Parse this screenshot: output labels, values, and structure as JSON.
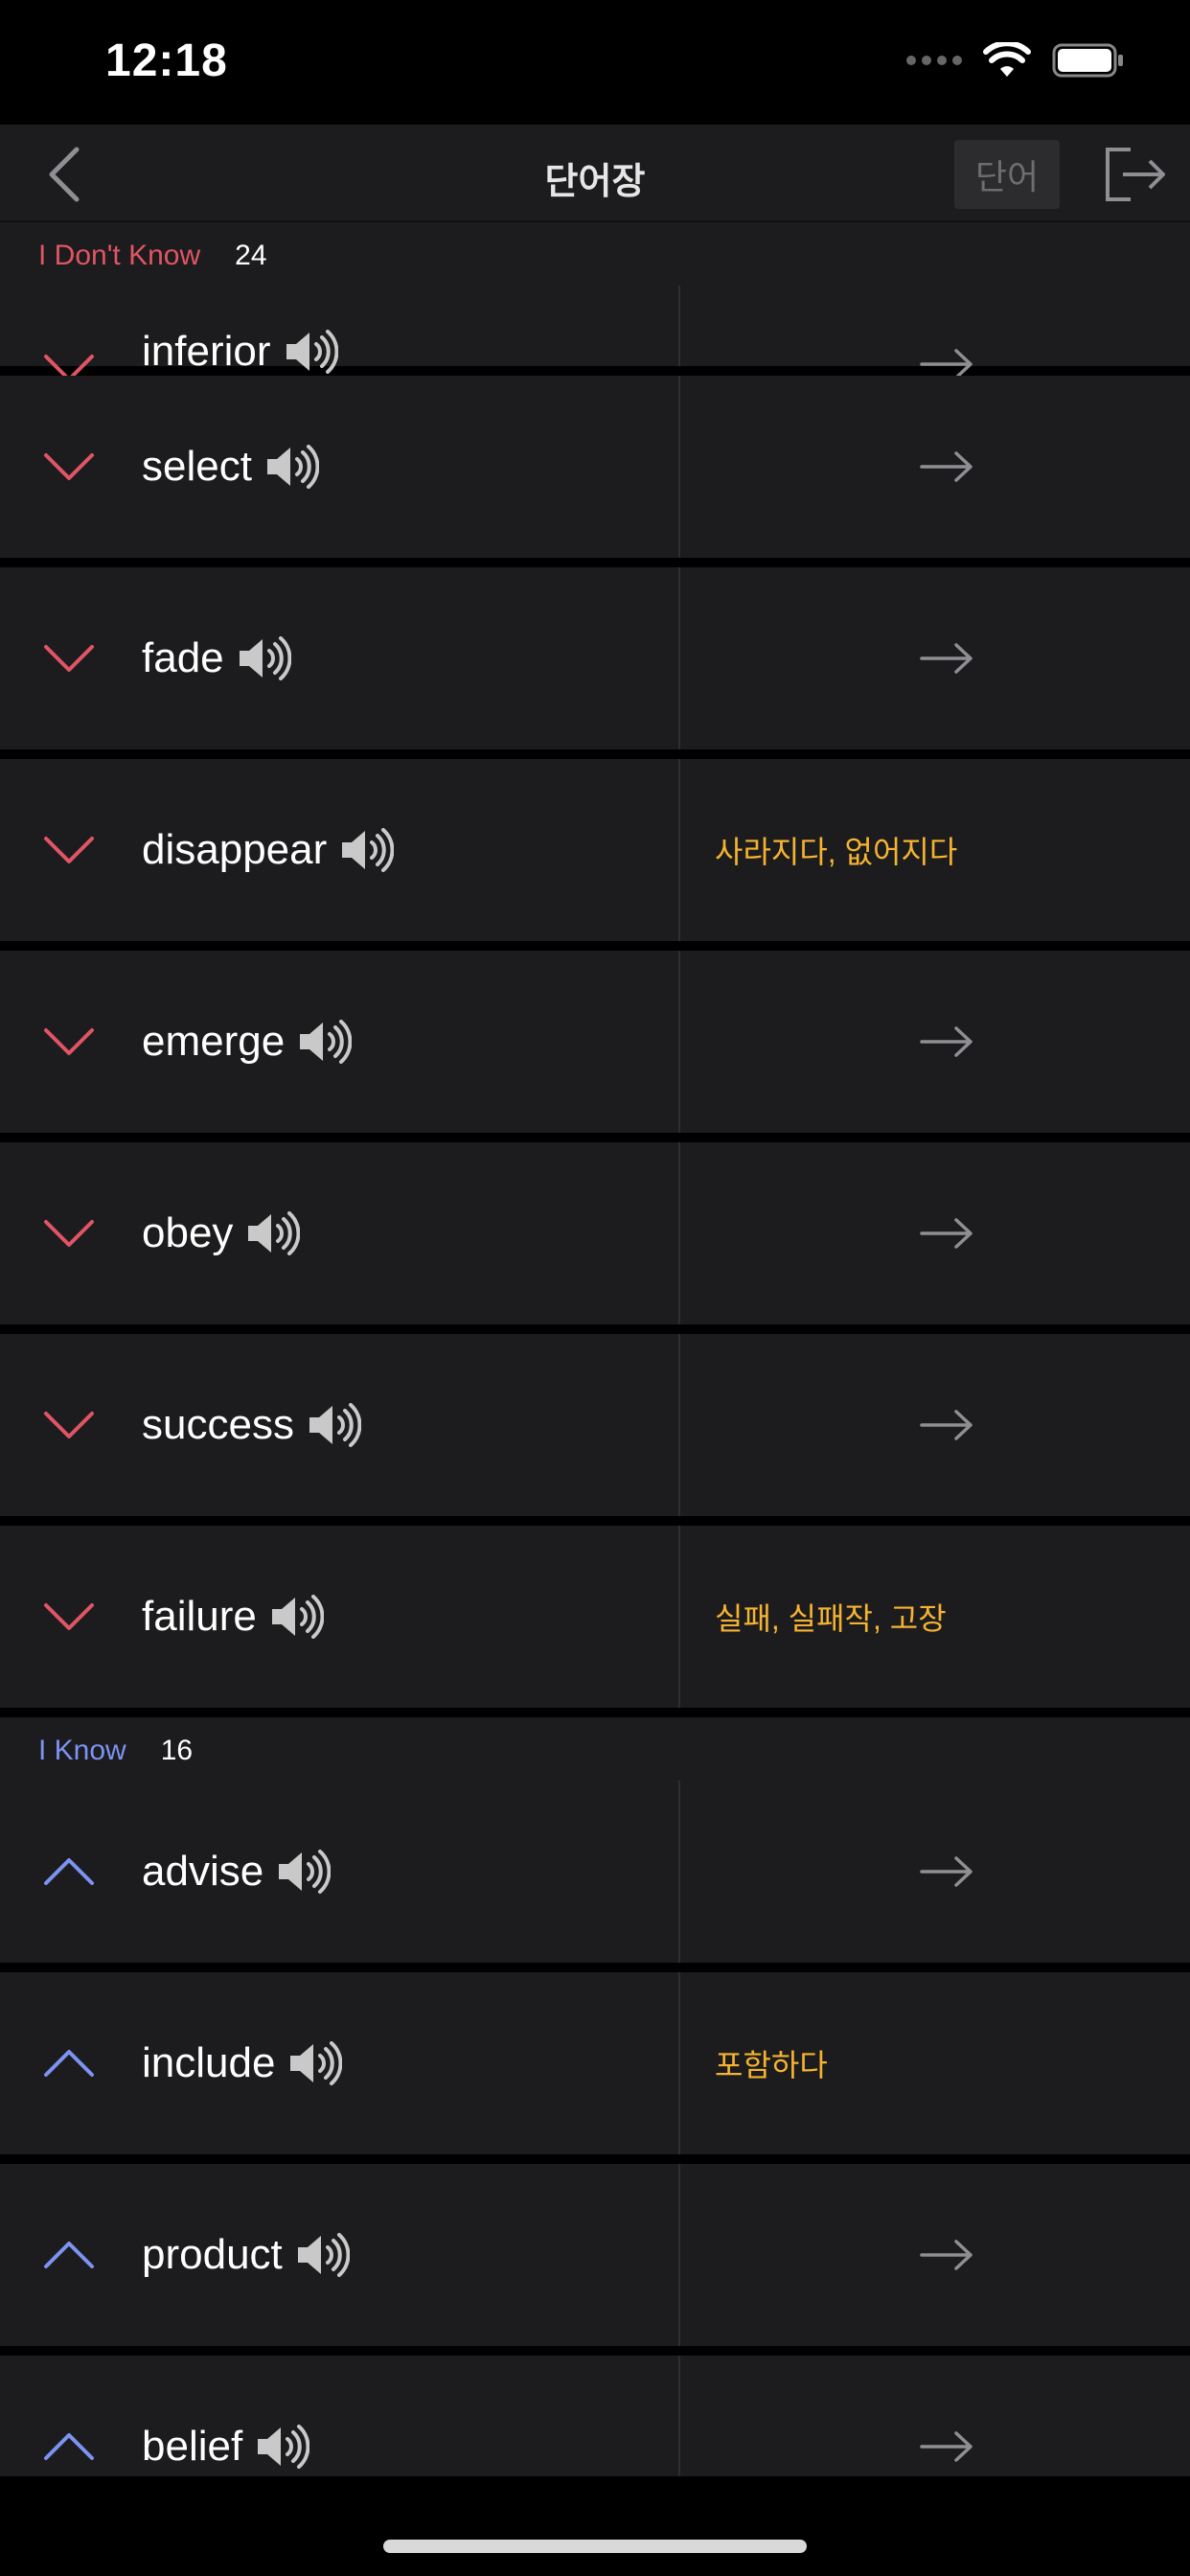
{
  "status_bar": {
    "time": "12:18"
  },
  "nav": {
    "title": "단어장",
    "mode_button": "단어"
  },
  "sections": [
    {
      "label": "I Don't Know",
      "count": "24",
      "color": "#e05563",
      "partial_word": "inferior",
      "items": [
        {
          "word": "select",
          "meaning": ""
        },
        {
          "word": "fade",
          "meaning": ""
        },
        {
          "word": "disappear",
          "meaning": "사라지다, 없어지다"
        },
        {
          "word": "emerge",
          "meaning": ""
        },
        {
          "word": "obey",
          "meaning": ""
        },
        {
          "word": "success",
          "meaning": ""
        },
        {
          "word": "failure",
          "meaning": "실패, 실패작, 고장"
        }
      ]
    },
    {
      "label": "I Know",
      "count": "16",
      "color": "#7c93f2",
      "items": [
        {
          "word": "advise",
          "meaning": ""
        },
        {
          "word": "include",
          "meaning": "포함하다"
        },
        {
          "word": "product",
          "meaning": ""
        },
        {
          "word": "belief",
          "meaning": ""
        }
      ]
    }
  ],
  "colors": {
    "background": "#000000",
    "row": "#1c1c1e",
    "meaning": "#f5b331",
    "arrow": "#8e8e93"
  }
}
